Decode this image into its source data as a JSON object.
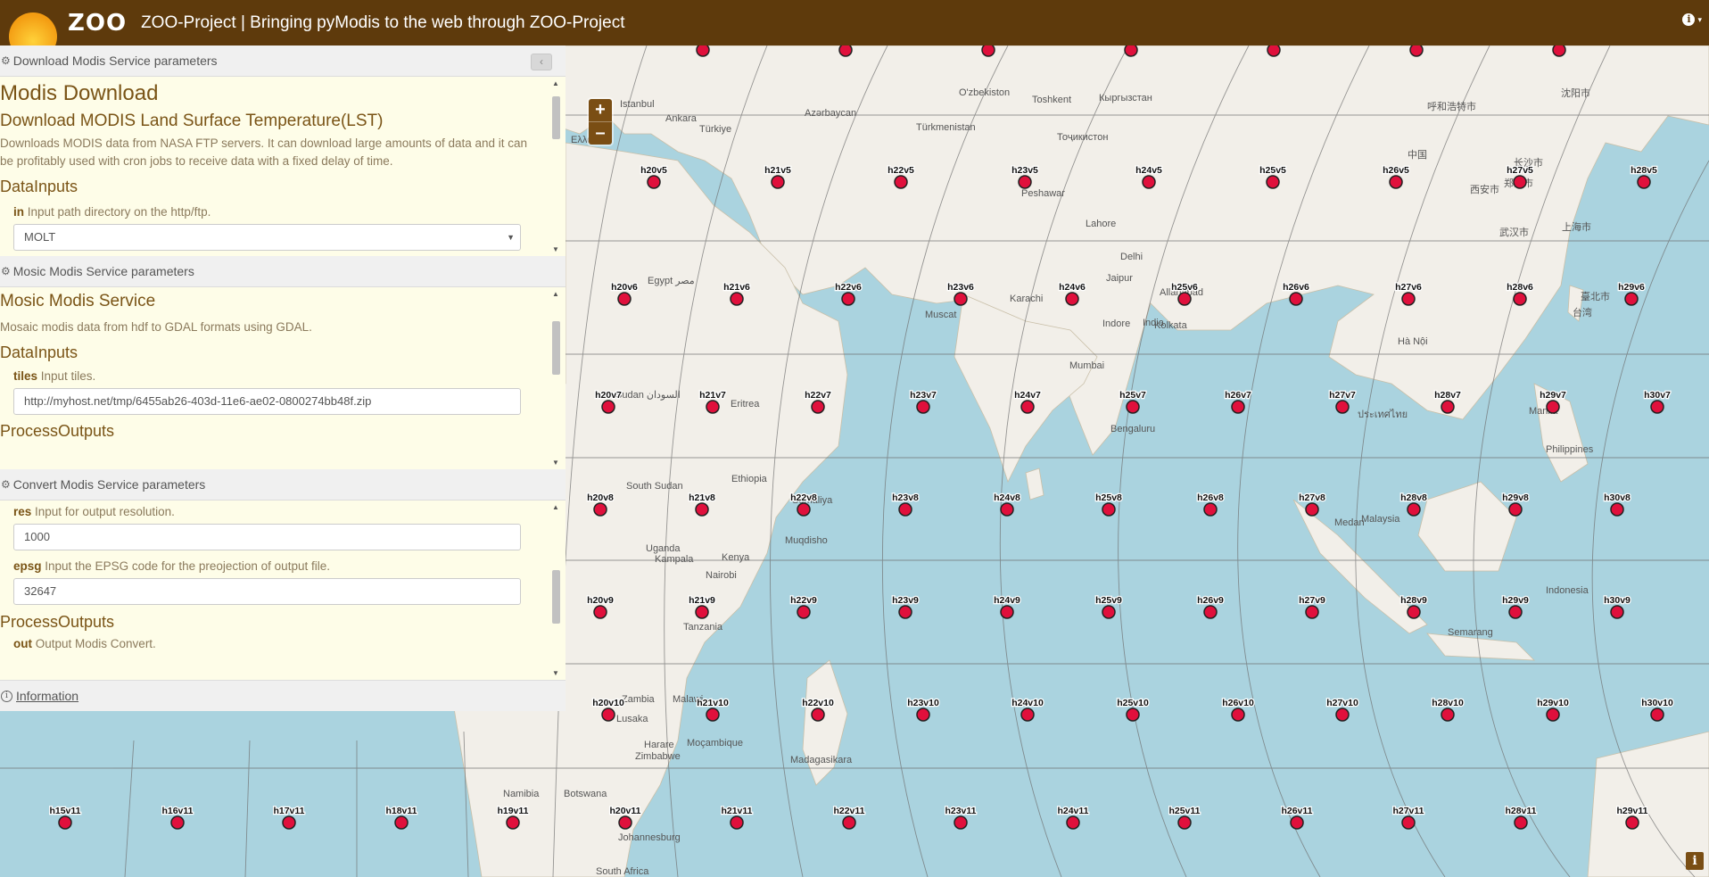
{
  "header": {
    "logo_text": "ZOO",
    "title": "ZOO-Project | Bringing pyModis to the web through ZOO-Project",
    "info_icon": "info-icon"
  },
  "map": {
    "zoom_in": "+",
    "zoom_out": "–",
    "attribution": "i",
    "tiles": [
      {
        "id": "h20v5",
        "label": "h20v5"
      },
      {
        "id": "h21v5",
        "label": "h21v5"
      },
      {
        "id": "h22v5",
        "label": "h22v5"
      },
      {
        "id": "h23v5",
        "label": "h23v5"
      },
      {
        "id": "h24v5",
        "label": "h24v5"
      },
      {
        "id": "h25v5",
        "label": "h25v5"
      },
      {
        "id": "h26v5",
        "label": "h26v5"
      },
      {
        "id": "h27v5",
        "label": "h27v5"
      },
      {
        "id": "h28v5",
        "label": "h28v5"
      },
      {
        "id": "h20v6",
        "label": "h20v6"
      },
      {
        "id": "h21v6",
        "label": "h21v6"
      },
      {
        "id": "h22v6",
        "label": "h22v6"
      },
      {
        "id": "h23v6",
        "label": "h23v6"
      },
      {
        "id": "h24v6",
        "label": "h24v6"
      },
      {
        "id": "h25v6",
        "label": "h25v6"
      },
      {
        "id": "h26v6",
        "label": "h26v6"
      },
      {
        "id": "h27v6",
        "label": "h27v6"
      },
      {
        "id": "h28v6",
        "label": "h28v6"
      },
      {
        "id": "h29v6",
        "label": "h29v6"
      },
      {
        "id": "h20v7",
        "label": "h20v7"
      },
      {
        "id": "h21v7",
        "label": "h21v7"
      },
      {
        "id": "h22v7",
        "label": "h22v7"
      },
      {
        "id": "h23v7",
        "label": "h23v7"
      },
      {
        "id": "h24v7",
        "label": "h24v7"
      },
      {
        "id": "h25v7",
        "label": "h25v7"
      },
      {
        "id": "h26v7",
        "label": "h26v7"
      },
      {
        "id": "h27v7",
        "label": "h27v7"
      },
      {
        "id": "h28v7",
        "label": "h28v7"
      },
      {
        "id": "h29v7",
        "label": "h29v7"
      },
      {
        "id": "h30v7",
        "label": "h30v7"
      },
      {
        "id": "h20v8",
        "label": "h20v8"
      },
      {
        "id": "h21v8",
        "label": "h21v8"
      },
      {
        "id": "h22v8",
        "label": "h22v8"
      },
      {
        "id": "h23v8",
        "label": "h23v8"
      },
      {
        "id": "h24v8",
        "label": "h24v8"
      },
      {
        "id": "h25v8",
        "label": "h25v8"
      },
      {
        "id": "h26v8",
        "label": "h26v8"
      },
      {
        "id": "h27v8",
        "label": "h27v8"
      },
      {
        "id": "h28v8",
        "label": "h28v8"
      },
      {
        "id": "h29v8",
        "label": "h29v8"
      },
      {
        "id": "h30v8",
        "label": "h30v8"
      },
      {
        "id": "h20v9",
        "label": "h20v9"
      },
      {
        "id": "h21v9",
        "label": "h21v9"
      },
      {
        "id": "h22v9",
        "label": "h22v9"
      },
      {
        "id": "h23v9",
        "label": "h23v9"
      },
      {
        "id": "h24v9",
        "label": "h24v9"
      },
      {
        "id": "h25v9",
        "label": "h25v9"
      },
      {
        "id": "h26v9",
        "label": "h26v9"
      },
      {
        "id": "h27v9",
        "label": "h27v9"
      },
      {
        "id": "h28v9",
        "label": "h28v9"
      },
      {
        "id": "h29v9",
        "label": "h29v9"
      },
      {
        "id": "h30v9",
        "label": "h30v9"
      },
      {
        "id": "h20v10",
        "label": "h20v10"
      },
      {
        "id": "h21v10",
        "label": "h21v10"
      },
      {
        "id": "h22v10",
        "label": "h22v10"
      },
      {
        "id": "h23v10",
        "label": "h23v10"
      },
      {
        "id": "h24v10",
        "label": "h24v10"
      },
      {
        "id": "h25v10",
        "label": "h25v10"
      },
      {
        "id": "h26v10",
        "label": "h26v10"
      },
      {
        "id": "h27v10",
        "label": "h27v10"
      },
      {
        "id": "h28v10",
        "label": "h28v10"
      },
      {
        "id": "h29v10",
        "label": "h29v10"
      },
      {
        "id": "h30v10",
        "label": "h30v10"
      },
      {
        "id": "h15v11",
        "label": "h15v11"
      },
      {
        "id": "h16v11",
        "label": "h16v11"
      },
      {
        "id": "h17v11",
        "label": "h17v11"
      },
      {
        "id": "h18v11",
        "label": "h18v11"
      },
      {
        "id": "h19v11",
        "label": "h19v11"
      },
      {
        "id": "h20v11",
        "label": "h20v11"
      },
      {
        "id": "h21v11",
        "label": "h21v11"
      },
      {
        "id": "h22v11",
        "label": "h22v11"
      },
      {
        "id": "h23v11",
        "label": "h23v11"
      },
      {
        "id": "h24v11",
        "label": "h24v11"
      },
      {
        "id": "h25v11",
        "label": "h25v11"
      },
      {
        "id": "h26v11",
        "label": "h26v11"
      },
      {
        "id": "h27v11",
        "label": "h27v11"
      },
      {
        "id": "h28v11",
        "label": "h28v11"
      },
      {
        "id": "h29v11",
        "label": "h29v11"
      }
    ],
    "place_labels": [
      "Istanbul",
      "Ankara",
      "Türkiye",
      "Ελλάδα",
      "Azərbaycan",
      "O'zbekiston",
      "Toshkent",
      "Кыргызстан",
      "Türkmenistan",
      "Тоҷикистон",
      "呼和浩特市",
      "沈阳市",
      "Egypt مصر",
      "Peshawar",
      "Lahore",
      "Delhi",
      "Jaipur",
      "Karachi",
      "Muscat",
      "Indore",
      "India",
      "Allahabad",
      "Kolkata",
      "Mumbai",
      "Bengaluru",
      "Hà Nội",
      "Manila",
      "Philippines",
      "Sudan السودان",
      "Eritrea",
      "Ethiopia",
      "Somaliya",
      "South Sudan",
      "Muqdisho",
      "Uganda",
      "Kampala",
      "Kenya",
      "Nairobi",
      "Tanzania",
      "Zambia",
      "Malawi",
      "Lusaka",
      "Harare",
      "Zimbabwe",
      "Moçambique",
      "Madagasikara",
      "Namibia",
      "Botswana",
      "Johannesburg",
      "South Africa",
      "Malaysia",
      "Indonesia",
      "Medan",
      "Semarang",
      "上海市",
      "武汉市",
      "长沙市",
      "郑州市",
      "西安市",
      "中国",
      "臺北市",
      "台湾",
      "ประเทศไทย"
    ]
  },
  "panels": [
    {
      "header": "Download Modis Service parameters",
      "title": "Modis Download",
      "subtitle": "Download MODIS Land Surface Temperature(LST)",
      "description": "Downloads MODIS data from NASA FTP servers. It can download large amounts of data and it can be profitably used with cron jobs to receive data with a fixed delay of time.",
      "section": "DataInputs",
      "field_name": "in",
      "field_desc": " Input path directory on the http/ftp.",
      "select_value": "MOLT"
    },
    {
      "header": "Mosic Modis Service parameters",
      "title": "Mosic Modis Service",
      "description": "Mosaic modis data from hdf to GDAL formats using GDAL.",
      "section": "DataInputs",
      "field_name": "tiles",
      "field_desc": " Input tiles.",
      "input_value": "http://myhost.net/tmp/6455ab26-403d-11e6-ae02-0800274bb48f.zip",
      "section2": "ProcessOutputs"
    },
    {
      "header": "Convert Modis Service parameters",
      "res_name": "res",
      "res_desc": " Input for output resolution.",
      "res_value": "1000",
      "epsg_name": "epsg",
      "epsg_desc": " Input the EPSG code for the preojection of output file.",
      "epsg_value": "32647",
      "section": "ProcessOutputs",
      "out_name": "out",
      "out_desc": " Output Modis Convert."
    }
  ],
  "information": "Information",
  "colors": {
    "header_bg": "#5e3a0c",
    "panel_bg": "#fefde8",
    "tile_marker": "#e0103c",
    "water": "#aad3df",
    "land": "#f2efe9"
  }
}
